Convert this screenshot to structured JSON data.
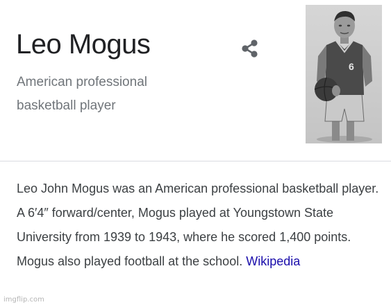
{
  "entity": {
    "title": "Leo Mogus",
    "subtitle": "American professional basketball player"
  },
  "photo": {
    "jersey_number": "6"
  },
  "description": {
    "text": "Leo John Mogus was an American professional basketball player. A 6′4″ forward/center, Mogus played at Youngstown State University from 1939 to 1943, where he scored 1,400 points. Mogus also played football at the school. ",
    "source_label": "Wikipedia"
  },
  "icons": {
    "share": "share-icon"
  },
  "colors": {
    "title": "#202124",
    "subtitle": "#70757a",
    "body_text": "#3c4043",
    "link": "#1a0dab",
    "divider": "#dadce0"
  },
  "watermark": "imgflip.com"
}
